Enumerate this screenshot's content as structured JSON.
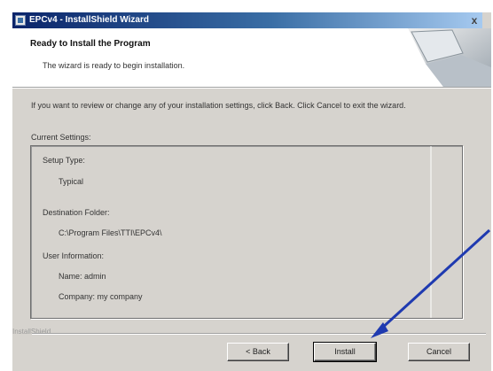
{
  "window": {
    "title": "EPCv4 - InstallShield Wizard",
    "close_glyph": "x"
  },
  "header": {
    "title": "Ready to Install the Program",
    "subtitle": "The wizard is ready to begin installation."
  },
  "instruction": "If you want to review or change any of your installation settings, click Back. Click Cancel to exit the wizard.",
  "current_settings_label": "Current Settings:",
  "settings": {
    "setup_type_label": "Setup Type:",
    "setup_type_value": "Typical",
    "destination_label": "Destination Folder:",
    "destination_value": "C:\\Program Files\\TTI\\EPCv4\\",
    "user_info_label": "User Information:",
    "name_line": "Name: admin",
    "company_line": "Company: my company"
  },
  "brand": "InstallShield",
  "buttons": {
    "back": "< Back",
    "install": "Install",
    "cancel": "Cancel"
  },
  "colors": {
    "titlebar_start": "#0a246a",
    "dialog_bg": "#d6d3ce",
    "annotation_arrow": "#1f3ab0"
  }
}
